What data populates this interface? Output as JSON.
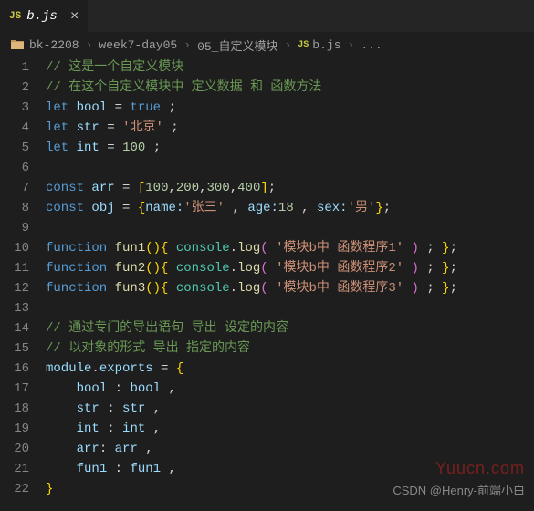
{
  "tab": {
    "icon_text": "JS",
    "label": "b.js",
    "close": "×"
  },
  "breadcrumb": {
    "items": [
      "bk-2208",
      "week7-day05",
      "05_自定义模块"
    ],
    "js_icon": "JS",
    "file": "b.js",
    "ellipsis": "..."
  },
  "lines": [
    {
      "n": "1",
      "html": "<span class='comment'>// 这是一个自定义模块</span>"
    },
    {
      "n": "2",
      "html": "<span class='comment'>// 在这个自定义模块中 定义数据 和 函数方法</span>"
    },
    {
      "n": "3",
      "html": "<span class='keyword'>let</span> <span class='var'>bool</span> <span class='punct'>=</span> <span class='bool-lit'>true</span> <span class='punct'>;</span>"
    },
    {
      "n": "4",
      "html": "<span class='keyword'>let</span> <span class='var'>str</span> <span class='punct'>=</span> <span class='string'>'北京'</span> <span class='punct'>;</span>"
    },
    {
      "n": "5",
      "html": "<span class='keyword'>let</span> <span class='var'>int</span> <span class='punct'>=</span> <span class='number'>100</span> <span class='punct'>;</span>"
    },
    {
      "n": "6",
      "html": ""
    },
    {
      "n": "7",
      "html": "<span class='const-kw'>const</span> <span class='var'>arr</span> <span class='punct'>=</span> <span class='brace'>[</span><span class='number'>100</span><span class='punct'>,</span><span class='number'>200</span><span class='punct'>,</span><span class='number'>300</span><span class='punct'>,</span><span class='number'>400</span><span class='brace'>]</span><span class='punct'>;</span>"
    },
    {
      "n": "8",
      "html": "<span class='const-kw'>const</span> <span class='var'>obj</span> <span class='punct'>=</span> <span class='brace'>{</span><span class='prop'>name:</span><span class='string'>'张三'</span> <span class='punct'>,</span> <span class='prop'>age:</span><span class='number'>18</span> <span class='punct'>,</span> <span class='prop'>sex:</span><span class='string'>'男'</span><span class='brace'>}</span><span class='punct'>;</span>"
    },
    {
      "n": "9",
      "html": ""
    },
    {
      "n": "10",
      "html": "<span class='keyword'>function</span> <span class='func'>fun1</span><span class='brace'>(</span><span class='brace'>)</span><span class='brace'>{</span> <span class='object'>console</span><span class='punct'>.</span><span class='func'>log</span><span class='brace2'>(</span> <span class='string'>'模块b中 函数程序1'</span> <span class='brace2'>)</span> <span class='punct'>;</span> <span class='brace'>}</span><span class='punct'>;</span>"
    },
    {
      "n": "11",
      "html": "<span class='keyword'>function</span> <span class='func'>fun2</span><span class='brace'>(</span><span class='brace'>)</span><span class='brace'>{</span> <span class='object'>console</span><span class='punct'>.</span><span class='func'>log</span><span class='brace2'>(</span> <span class='string'>'模块b中 函数程序2'</span> <span class='brace2'>)</span> <span class='punct'>;</span> <span class='brace'>}</span><span class='punct'>;</span>"
    },
    {
      "n": "12",
      "html": "<span class='keyword'>function</span> <span class='func'>fun3</span><span class='brace'>(</span><span class='brace'>)</span><span class='brace'>{</span> <span class='object'>console</span><span class='punct'>.</span><span class='func'>log</span><span class='brace2'>(</span> <span class='string'>'模块b中 函数程序3'</span> <span class='brace2'>)</span> <span class='punct'>;</span> <span class='brace'>}</span><span class='punct'>;</span>"
    },
    {
      "n": "13",
      "html": ""
    },
    {
      "n": "14",
      "html": "<span class='comment'>// 通过专门的导出语句 导出 设定的内容</span>"
    },
    {
      "n": "15",
      "html": "<span class='comment'>// 以对象的形式 导出 指定的内容</span>"
    },
    {
      "n": "16",
      "html": "<span class='var'>module</span><span class='punct'>.</span><span class='var'>exports</span> <span class='punct'>=</span> <span class='brace'>{</span>"
    },
    {
      "n": "17",
      "html": "    <span class='prop'>bool</span> <span class='punct'>:</span> <span class='var'>bool</span> <span class='punct'>,</span>"
    },
    {
      "n": "18",
      "html": "    <span class='prop'>str</span> <span class='punct'>:</span> <span class='var'>str</span> <span class='punct'>,</span>"
    },
    {
      "n": "19",
      "html": "    <span class='prop'>int</span> <span class='punct'>:</span> <span class='var'>int</span> <span class='punct'>,</span>"
    },
    {
      "n": "20",
      "html": "    <span class='prop'>arr</span><span class='punct'>:</span> <span class='var'>arr</span> <span class='punct'>,</span>"
    },
    {
      "n": "21",
      "html": "    <span class='prop'>fun1</span> <span class='punct'>:</span> <span class='var'>fun1</span> <span class='punct'>,</span>"
    },
    {
      "n": "22",
      "html": "<span class='brace'>}</span>"
    }
  ],
  "watermarks": {
    "w1": "Yuucn.com",
    "w2": "CSDN @Henry-前端小白"
  }
}
